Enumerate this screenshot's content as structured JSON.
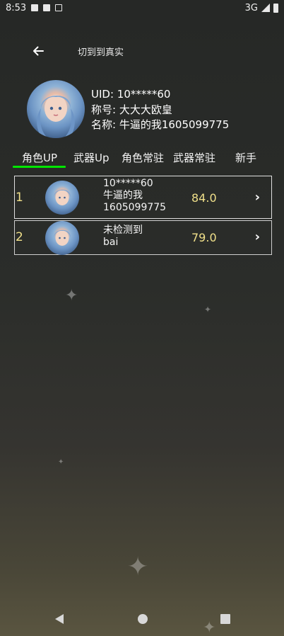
{
  "status_bar": {
    "time": "8:53",
    "network": "3G",
    "icons": [
      "notification-a-icon",
      "sd-card-icon",
      "sync-icon",
      "signal-icon",
      "battery-icon"
    ]
  },
  "header": {
    "back_icon": "arrow-left-icon",
    "switch_label": "切到到真实"
  },
  "profile": {
    "uid": "UID: 10*****60",
    "title": "称号: 大大大欧皇",
    "name": "名称: 牛逼的我1605099775"
  },
  "tabs": [
    {
      "label": "角色UP",
      "active": true
    },
    {
      "label": "武器Up",
      "active": false
    },
    {
      "label": "角色常驻",
      "active": false
    },
    {
      "label": "武器常驻",
      "active": false
    },
    {
      "label": "新手",
      "active": false
    }
  ],
  "accent_color": "#00e600",
  "score_color": "#f0e08a",
  "ranking": [
    {
      "rank": "1",
      "lines": [
        "10*****60",
        "牛逼的我",
        "1605099775"
      ],
      "score": "84.0",
      "arrow": "chevron-right-icon"
    },
    {
      "rank": "2",
      "lines": [
        "未检测到",
        "bai"
      ],
      "score": "79.0",
      "arrow": "chevron-right-icon"
    }
  ],
  "nav": {
    "back": "nav-back-icon",
    "home": "nav-home-icon",
    "recent": "nav-recent-icon"
  }
}
